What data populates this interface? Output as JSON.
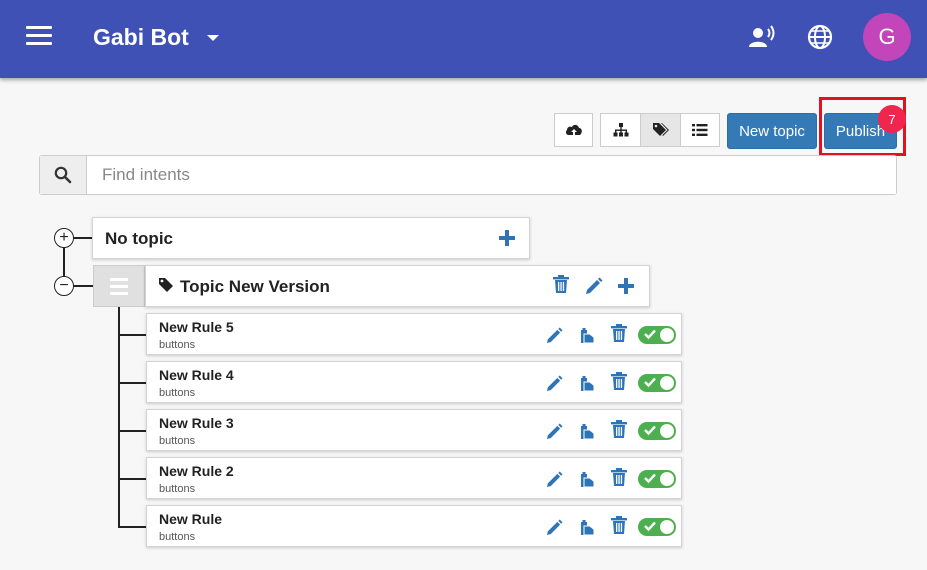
{
  "header": {
    "title": "Gabi Bot",
    "avatar_initial": "G",
    "accent_color": "#3f51b5",
    "avatar_color": "#c245ba"
  },
  "toolbar": {
    "new_topic_label": "New topic",
    "publish_label": "Publish",
    "publish_badge_count": "7",
    "icons": [
      "cloud-upload-icon",
      "sitemap-icon",
      "tags-icon",
      "list-icon"
    ]
  },
  "search": {
    "placeholder": "Find intents",
    "value": ""
  },
  "topics": [
    {
      "name": "No topic",
      "expanded": false
    },
    {
      "name": "Topic New Version",
      "expanded": true,
      "rules": [
        {
          "title": "New Rule 5",
          "subtitle": "buttons",
          "enabled": true
        },
        {
          "title": "New Rule 4",
          "subtitle": "buttons",
          "enabled": true
        },
        {
          "title": "New Rule 3",
          "subtitle": "buttons",
          "enabled": true
        },
        {
          "title": "New Rule 2",
          "subtitle": "buttons",
          "enabled": true
        },
        {
          "title": "New Rule",
          "subtitle": "buttons",
          "enabled": true
        }
      ]
    }
  ],
  "colors": {
    "primary_button": "#337ab7",
    "icon_blue": "#2f75b5",
    "toggle_on": "#4caf50",
    "badge": "#f0264f",
    "highlight": "#e0141e"
  }
}
